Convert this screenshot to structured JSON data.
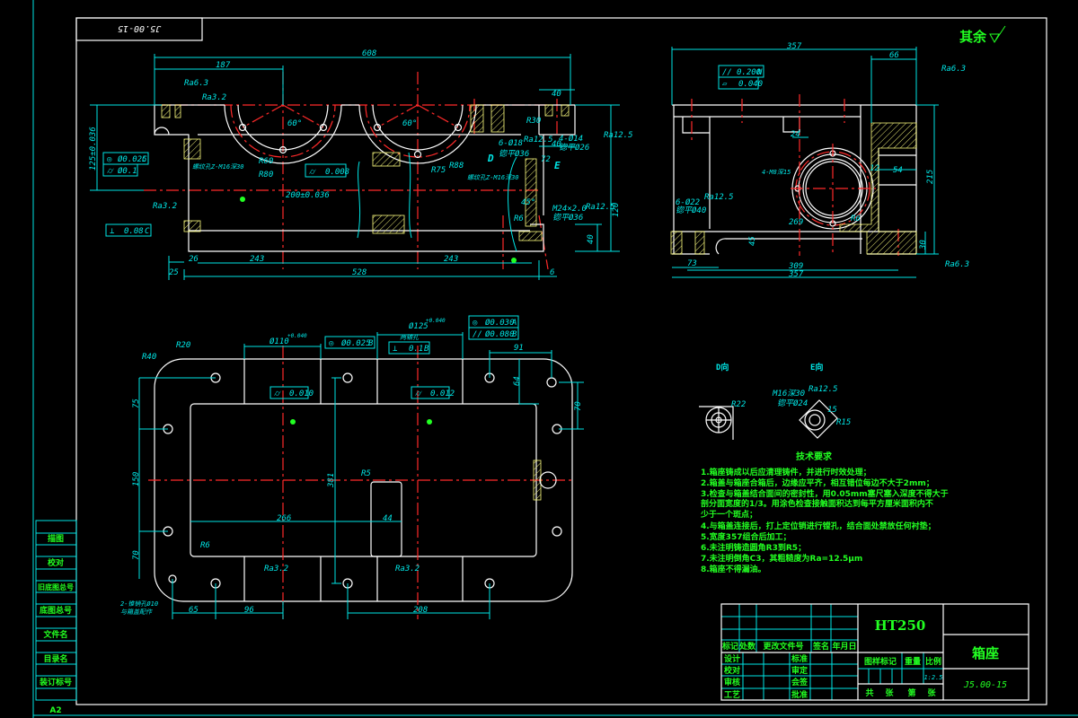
{
  "sheet": {
    "code_box": "J5.00-15",
    "remaining_roughness": "其余",
    "size_mark": "A2",
    "colors": {
      "outline": "#ffffff",
      "dimension": "#00e5e5",
      "centerline": "#ff2a2a",
      "hatch": "#ffff80",
      "annotation": "#22ff22"
    }
  },
  "left_table": [
    "描图",
    "校对",
    "旧底图总号",
    "底图总号",
    "文件名",
    "目录名",
    "装订标号"
  ],
  "front_view": {
    "dims": [
      "608",
      "187",
      "40",
      "40",
      "R30",
      "26",
      "243",
      "243",
      "528",
      "25",
      "6",
      "125±0.036",
      "200±0.036",
      "R60",
      "R80",
      "R75",
      "R88",
      "60°",
      "60°",
      "Ra6.3",
      "Ra3.2",
      "Ra3.2",
      "Ra12.5",
      "6-Ø18",
      "锪平Ø36",
      "D",
      "E",
      "R6",
      "4-Ø14",
      "锪平Ø26",
      "Ra12.5",
      "M24×2.0",
      "锪平Ø36",
      "Ra12.5",
      "45°",
      "72",
      "40",
      "120",
      "螺纹孔Z-M16深30",
      "螺纹孔Z-M16深30"
    ],
    "fcf": [
      {
        "symbol": "◎",
        "value": "Ø0.025",
        "datum": "C"
      },
      {
        "symbol": "⌭",
        "value": "Ø0.1",
        "datum": ""
      },
      {
        "symbol": "⌭",
        "value": "0.008",
        "datum": ""
      },
      {
        "symbol": "⊥",
        "value": "0.08",
        "datum": "C"
      }
    ]
  },
  "side_view": {
    "dims": [
      "357",
      "66",
      "Ra6.3",
      "24",
      "215",
      "54",
      "12",
      "4-M8深15",
      "6-Ø22",
      "锪平Ø40",
      "Ra12.5",
      "269",
      "R6",
      "30",
      "45",
      "73",
      "309",
      "357",
      "Ra6.3"
    ],
    "fcf": [
      {
        "symbol": "//",
        "value": "0.200",
        "datum": "N"
      },
      {
        "symbol": "▱",
        "value": "0.040",
        "datum": ""
      }
    ]
  },
  "plan_view": {
    "dims": [
      "R20",
      "R40",
      "Ø110",
      "+0.040",
      "Ø125",
      "+0.040",
      "91",
      "64",
      "70",
      "75",
      "150",
      "70",
      "381",
      "R5",
      "266",
      "44",
      "R6",
      "Ra3.2",
      "Ra3.2",
      "65",
      "96",
      "208",
      "2-锥销孔Ø10",
      "与箱盖配作",
      "两轴孔"
    ],
    "fcf": [
      {
        "symbol": "◎",
        "value": "Ø0.025",
        "datum": "B"
      },
      {
        "symbol": "⊥",
        "value": "0.1",
        "datum": "B"
      },
      {
        "symbol": "◎",
        "value": "Ø0.030",
        "datum": "A"
      },
      {
        "symbol": "//",
        "value": "Ø0.080",
        "datum": "B"
      },
      {
        "symbol": "⌭",
        "value": "0.010",
        "datum": ""
      },
      {
        "symbol": "⌭",
        "value": "0.012",
        "datum": ""
      }
    ]
  },
  "view_d": {
    "title": "D向",
    "dims": [
      "R22"
    ]
  },
  "view_e": {
    "title": "E向",
    "dims": [
      "M16深30",
      "锪平Ø24",
      "Ra12.5",
      "15",
      "R15"
    ]
  },
  "tech_requirements": {
    "title": "技术要求",
    "lines": [
      "1.箱座铸成以后应清理铸件，并进行时效处理；",
      "2.箱盖与箱座合箱后，边缘应平齐，相互错位每边不大于2mm；",
      "3.检查与箱盖结合面间的密封性，用0.05mm塞尺塞入深度不得大于",
      "剖分面宽度的1/3。用涂色检查接触面积达到每平方厘米面积内不",
      "少于一个斑点；",
      "4.与箱盖连接后，打上定位销进行镗孔，结合面处禁放任何衬垫；",
      "5.宽度357组合后加工；",
      "6.未注明铸造圆角R3到R5；",
      "7.未注明倒角C3，其粗糙度为Ra=12.5μm",
      "8.箱座不得漏油。"
    ]
  },
  "title_block": {
    "material": "HT250",
    "part_name": "箱座",
    "drawing_number": "J5.00-15",
    "revision_headers": [
      "标记",
      "处数",
      "更改文件号",
      "签名",
      "年月日"
    ],
    "signoff_left": [
      "设计",
      "校对",
      "审核",
      "工艺"
    ],
    "signoff_right": [
      "标准",
      "审定",
      "会签",
      "批准"
    ],
    "meta_headers": [
      "图样标记",
      "重量",
      "比例"
    ],
    "scale": "1:2.5",
    "sheet_info": [
      "共",
      "张",
      "第",
      "张"
    ]
  }
}
